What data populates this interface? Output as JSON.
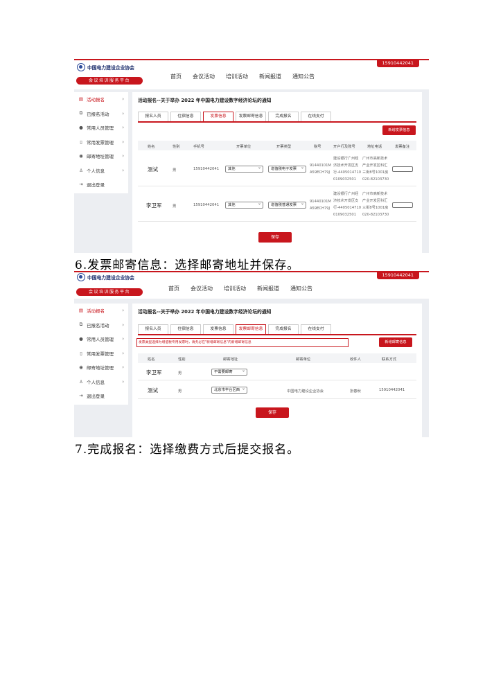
{
  "header": {
    "org_name": "中国电力建设企业协会",
    "platform": "会议培训服务平台",
    "phone": "15910442041",
    "nav": [
      "首页",
      "会议活动",
      "培训活动",
      "新闻报道",
      "通知公告"
    ]
  },
  "sidebar": {
    "items": [
      {
        "label": "活动报名",
        "icon": "doc-icon"
      },
      {
        "label": "已报名活动",
        "icon": "copy-icon"
      },
      {
        "label": "常用人员管理",
        "icon": "users-icon"
      },
      {
        "label": "常用发票管理",
        "icon": "file-icon"
      },
      {
        "label": "邮寄地址管理",
        "icon": "location-icon"
      },
      {
        "label": "个人信息",
        "icon": "person-icon"
      },
      {
        "label": "退出登录",
        "icon": "logout-icon"
      }
    ]
  },
  "panel": {
    "title": "活动报名--关于举办 2022 年中国电力建设数字经济论坛的通知",
    "tabs": [
      "报名人员",
      "住宿信息",
      "发票信息",
      "发票邮寄信息",
      "完成报名",
      "在线支付"
    ],
    "save_label": "保存"
  },
  "screenshot1": {
    "active_tab": "发票信息",
    "add_button": "新增发票信息",
    "columns": [
      "姓名",
      "性别",
      "手机号",
      "开票单位",
      "开票类型",
      "税号",
      "开户行及账号",
      "地址电话",
      "发票备注"
    ],
    "rows": [
      {
        "name": "测试",
        "gender": "男",
        "phone": "15910442041",
        "unit": "其他",
        "type": "增值税电子发票",
        "tax": [
          "91440101M",
          "A59ECH79J"
        ],
        "bank": [
          "建设银行广州经",
          "济技术开发区支",
          "行-4405014710",
          "0109032501"
        ],
        "addr": [
          "广州市高新技术",
          "产业开发区科汇",
          "三街8号1001房",
          "020-82103730"
        ]
      },
      {
        "name": "李卫军",
        "gender": "男",
        "phone": "15910442041",
        "unit": "其他",
        "type": "增值税普通发票",
        "tax": [
          "91440101M",
          "A59ECH79J"
        ],
        "bank": [
          "建设银行广州经",
          "济技术开发区支",
          "行-4405014710",
          "0109032501"
        ],
        "addr": [
          "广州市高新技术",
          "产业开发区科汇",
          "三街8号1001房",
          "020-82103730"
        ]
      }
    ]
  },
  "caption1": "6.发票邮寄信息：选择邮寄地址并保存。",
  "screenshot2": {
    "active_tab": "发票邮寄信息",
    "notice": "发票类型选择为增值税专用发票时，请务必在\"新增邮寄信息\"内新增邮寄信息",
    "add_button": "新增邮寄信息",
    "columns": [
      "姓名",
      "性别",
      "邮寄地址",
      "邮寄单位",
      "收件人",
      "联系方式"
    ],
    "rows": [
      {
        "name": "李卫军",
        "gender": "男",
        "address": "不需要邮寄",
        "unit": "",
        "recipient": "",
        "contact": ""
      },
      {
        "name": "测试",
        "gender": "男",
        "address": "北京市丰台区西",
        "unit": "中国电力建设企业协会",
        "recipient": "张春秋",
        "contact": "15910442041"
      }
    ]
  },
  "caption2": "7.完成报名：选择缴费方式后提交报名。"
}
